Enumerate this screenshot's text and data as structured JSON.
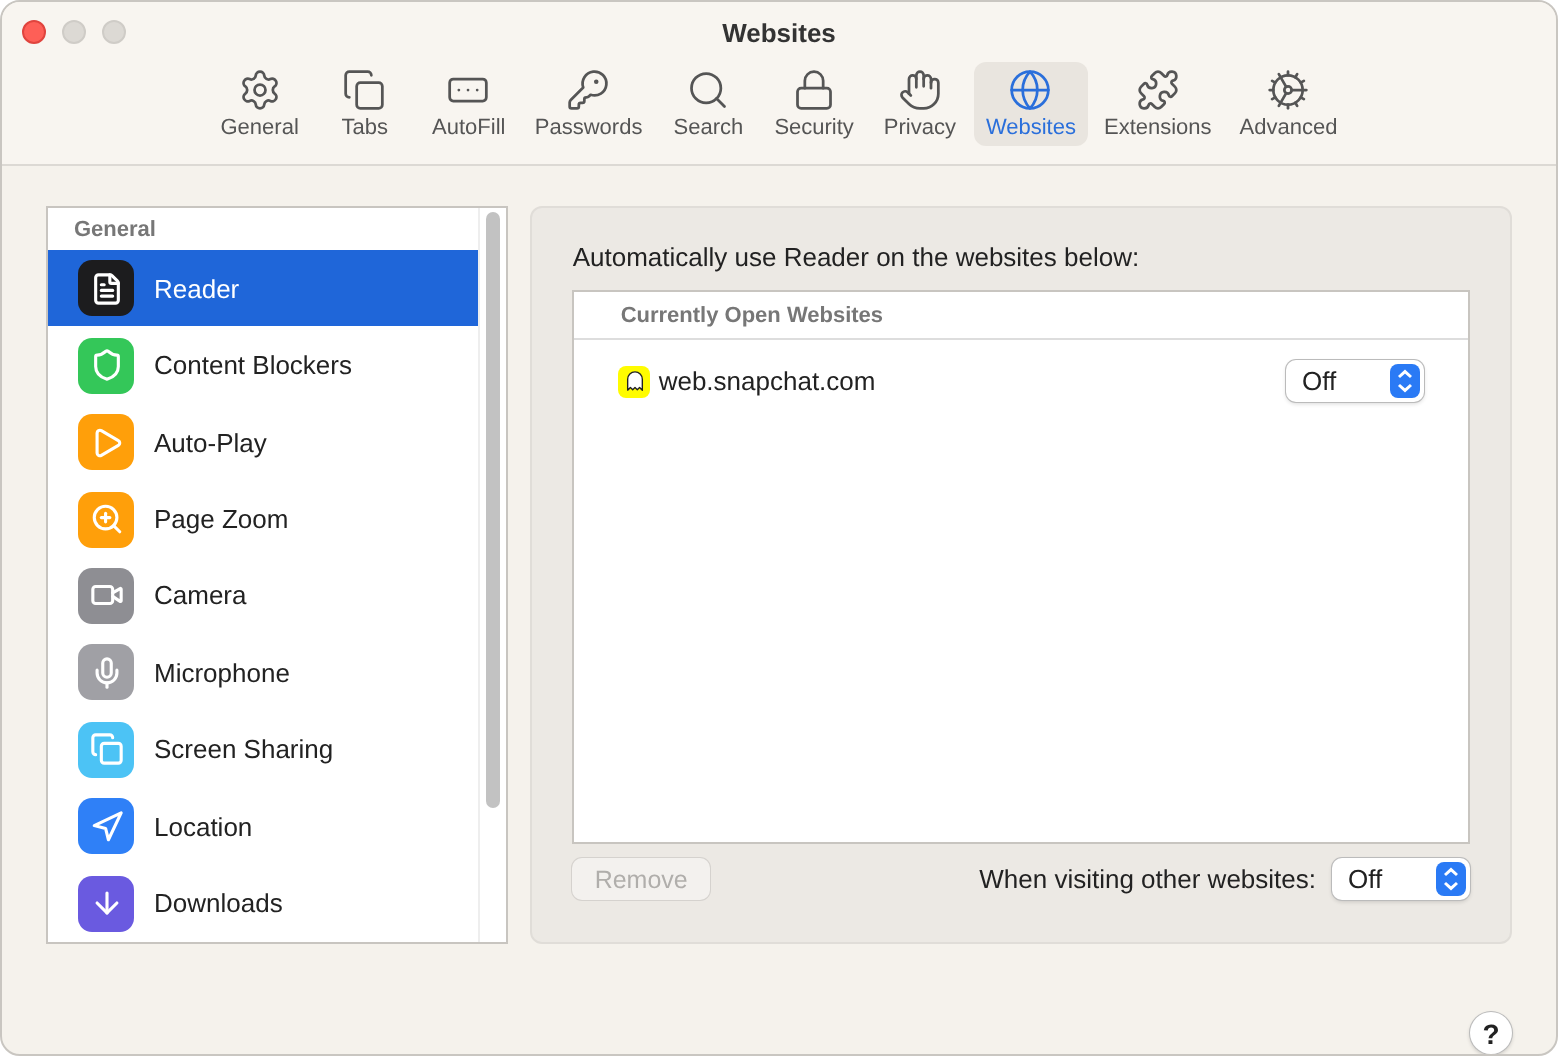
{
  "window": {
    "title": "Websites"
  },
  "toolbar": [
    {
      "label": "General",
      "selected": false
    },
    {
      "label": "Tabs",
      "selected": false
    },
    {
      "label": "AutoFill",
      "selected": false
    },
    {
      "label": "Passwords",
      "selected": false
    },
    {
      "label": "Search",
      "selected": false
    },
    {
      "label": "Security",
      "selected": false
    },
    {
      "label": "Privacy",
      "selected": false
    },
    {
      "label": "Websites",
      "selected": true
    },
    {
      "label": "Extensions",
      "selected": false
    },
    {
      "label": "Advanced",
      "selected": false
    }
  ],
  "sidebar": {
    "header": "General",
    "items": [
      {
        "label": "Reader",
        "selected": true
      },
      {
        "label": "Content Blockers",
        "selected": false
      },
      {
        "label": "Auto-Play",
        "selected": false
      },
      {
        "label": "Page Zoom",
        "selected": false
      },
      {
        "label": "Camera",
        "selected": false
      },
      {
        "label": "Microphone",
        "selected": false
      },
      {
        "label": "Screen Sharing",
        "selected": false
      },
      {
        "label": "Location",
        "selected": false
      },
      {
        "label": "Downloads",
        "selected": false
      }
    ]
  },
  "panel": {
    "description": "Automatically use Reader on the websites below:",
    "list_header": "Currently Open Websites",
    "websites": [
      {
        "name": "web.snapchat.com",
        "setting": "Off"
      }
    ],
    "remove_button": {
      "label": "Remove",
      "disabled": true
    },
    "other_label": "When visiting other websites:",
    "other_setting": "Off"
  },
  "help_button": "?"
}
